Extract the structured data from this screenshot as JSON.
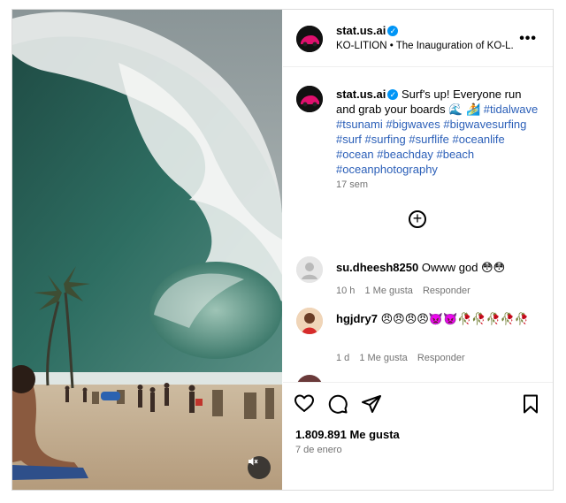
{
  "post": {
    "username": "stat.us.ai",
    "subtitle": "KO-LITION • The Inauguration of KO-L..."
  },
  "caption": {
    "username": "stat.us.ai",
    "text": "Surf's up! Everyone run and grab your boards 🌊 🏄 ",
    "hashtags": "#tidalwave #tsunami #bigwaves #bigwavesurfing #surf #surfing #surflife #oceanlife #ocean #beachday #beach #oceanphotography",
    "time": "17 sem"
  },
  "comments": [
    {
      "username": "su.dheesh8250",
      "text": "Owww god 😳😳",
      "time": "10 h",
      "likes": "1 Me gusta",
      "reply": "Responder"
    },
    {
      "username": "hgjdry7",
      "text": "😠😠😠😠👿👿🥀🥀🥀🥀🥀",
      "time": "1 d",
      "likes": "1 Me gusta",
      "reply": "Responder"
    }
  ],
  "footer": {
    "likes": "1.809.891 Me gusta",
    "date": "7 de enero"
  },
  "colors": {
    "verified": "#0095f6",
    "hashtag": "#2b5fb8"
  }
}
